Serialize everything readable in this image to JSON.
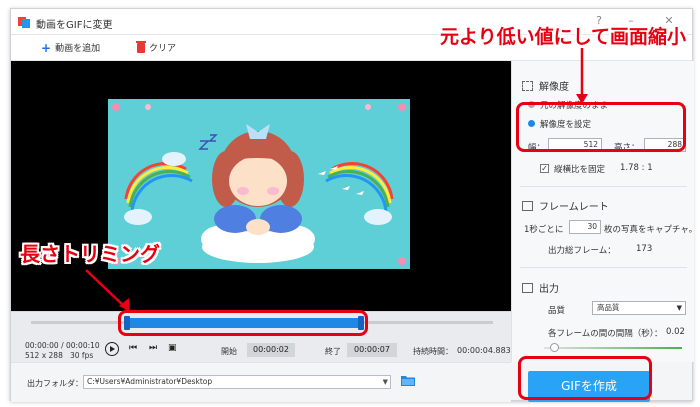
{
  "window": {
    "title": "動画をGIFに変更",
    "controls": [
      "?",
      "–",
      "✕"
    ]
  },
  "toolbar": {
    "add_label": "動画を追加",
    "clear_label": "クリア"
  },
  "player": {
    "time_current": "00:00:00",
    "time_total": "00:00:10",
    "resolution": "512 x 288",
    "fps": "30 fps",
    "start_label": "開始",
    "start_value": "00:00:02",
    "end_label": "終了",
    "end_value": "00:00:07",
    "duration_label": "持続時間：",
    "duration_value": "00:00:04.883"
  },
  "output": {
    "label": "出力フォルダ：",
    "path": "C:¥Users¥Administrator¥Desktop"
  },
  "settings": {
    "resolution_title": "解像度",
    "keep_original": "元の解像度のまま",
    "set_resolution": "解像度を設定",
    "width_label": "幅：",
    "width_value": "512",
    "height_label": "高さ：",
    "height_value": "288",
    "keep_ratio": "縦横比を固定",
    "ratio_value": "1.78 : 1",
    "framerate_title": "フレームレート",
    "per_second_prefix": "1秒ごとに",
    "per_second_value": "30",
    "per_second_suffix": "枚の写真をキャプチャ。",
    "total_frames_label": "出力総フレーム：",
    "total_frames_value": "173",
    "output_title": "出力",
    "quality_label": "品質",
    "quality_value": "高品質",
    "interval_label": "各フレームの間の間隔（秒）：",
    "interval_value": "0.02"
  },
  "create_label": "GIFを作成",
  "annotations": {
    "resolution_note": "元より低い値にして画面縮小",
    "trim_note": "長さトリミング"
  },
  "colors": {
    "accent_blue": "#29a3f5",
    "annotation_red": "#e60012"
  }
}
